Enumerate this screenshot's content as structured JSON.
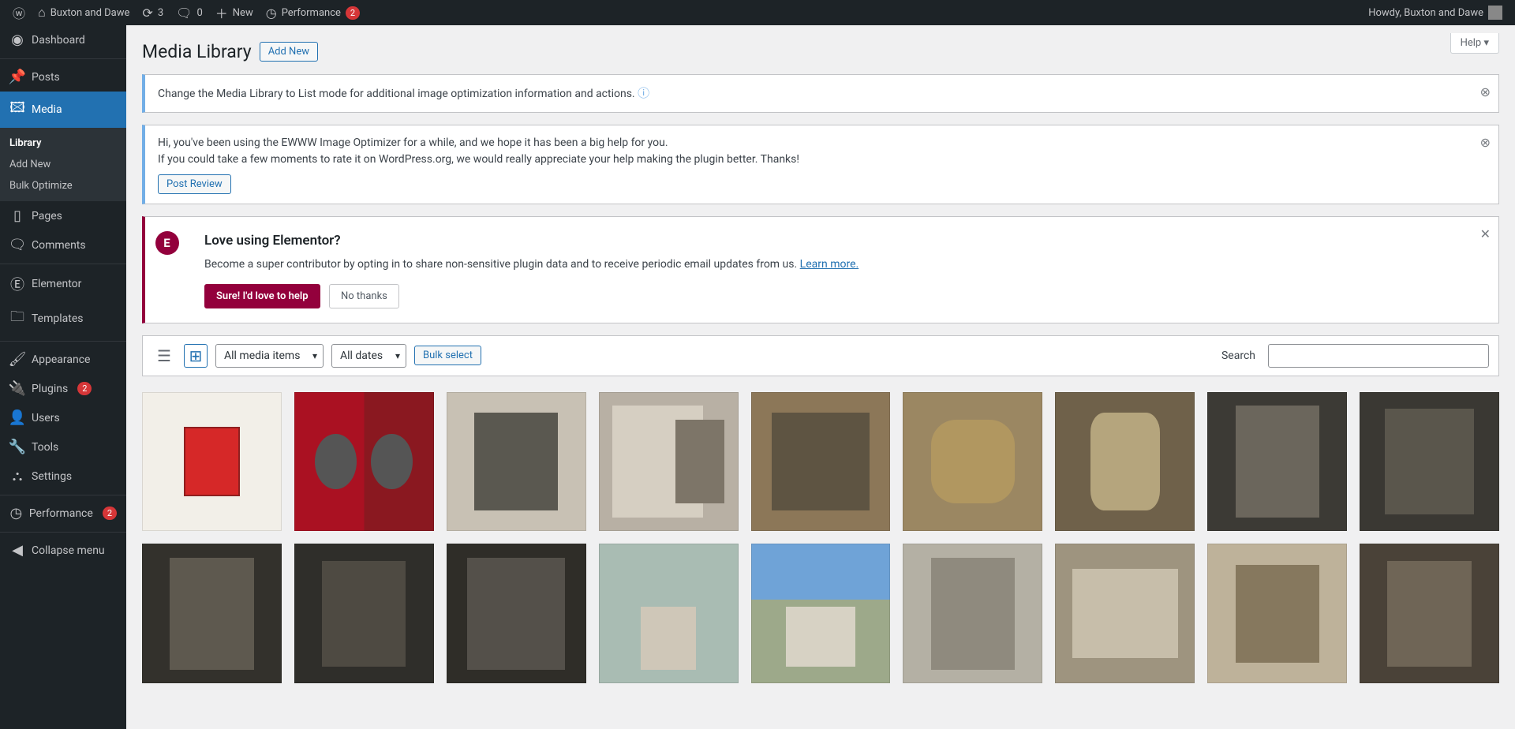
{
  "adminbar": {
    "site_name": "Buxton and Dawe",
    "updates_count": "3",
    "comments_count": "0",
    "new_label": "New",
    "perf_label": "Performance",
    "perf_count": "2",
    "howdy": "Howdy, Buxton and Dawe"
  },
  "sidebar": {
    "dashboard": "Dashboard",
    "posts": "Posts",
    "media": "Media",
    "media_sub": {
      "library": "Library",
      "add_new": "Add New",
      "bulk_optimize": "Bulk Optimize"
    },
    "pages": "Pages",
    "comments": "Comments",
    "elementor": "Elementor",
    "templates": "Templates",
    "appearance": "Appearance",
    "plugins": "Plugins",
    "plugins_count": "2",
    "users": "Users",
    "tools": "Tools",
    "settings": "Settings",
    "performance": "Performance",
    "performance_count": "2",
    "collapse": "Collapse menu"
  },
  "header": {
    "title": "Media Library",
    "add_new": "Add New",
    "help": "Help"
  },
  "notice_list": {
    "text": "Change the Media Library to List mode for additional image optimization information and actions."
  },
  "notice_ewww": {
    "line1": "Hi, you've been using the EWWW Image Optimizer for a while, and we hope it has been a big help for you.",
    "line2": "If you could take a few moments to rate it on WordPress.org, we would really appreciate your help making the plugin better. Thanks!",
    "button": "Post Review"
  },
  "notice_elementor": {
    "title": "Love using Elementor?",
    "text": "Become a super contributor by opting in to share non-sensitive plugin data and to receive periodic email updates from us. ",
    "learn_more": "Learn more.",
    "yes": "Sure! I'd love to help",
    "no": "No thanks"
  },
  "toolbar": {
    "filter_type": "All media items",
    "filter_date": "All dates",
    "bulk_select": "Bulk select",
    "search_label": "Search"
  }
}
